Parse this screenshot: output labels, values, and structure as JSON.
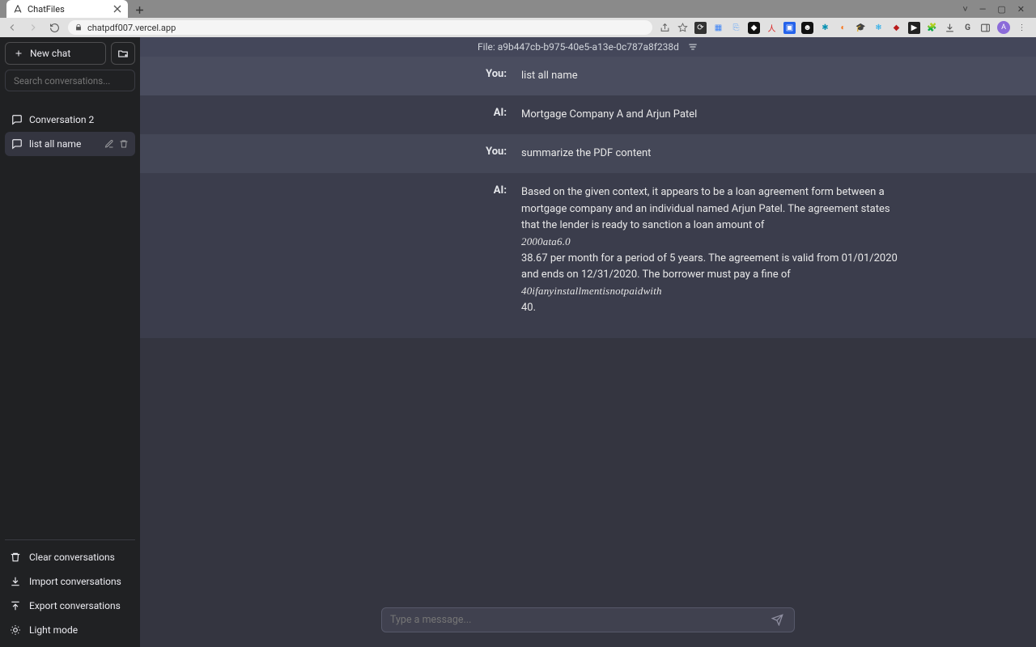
{
  "browser": {
    "tab_title": "ChatFiles",
    "url": "chatpdf007.vercel.app",
    "profile_initial": "A"
  },
  "sidebar": {
    "new_chat": "New chat",
    "search_placeholder": "Search conversations...",
    "conversations": [
      {
        "title": "Conversation 2"
      },
      {
        "title": "list all name"
      }
    ],
    "footer": {
      "clear": "Clear conversations",
      "import": "Import conversations",
      "export": "Export conversations",
      "light": "Light mode"
    }
  },
  "file_bar": {
    "label": "File: a9b447cb-b975-40e5-a13e-0c787a8f238d"
  },
  "labels": {
    "you": "You:",
    "ai": "AI:"
  },
  "messages": {
    "m0": {
      "role": "You:",
      "text": "list all name"
    },
    "m1": {
      "role": "AI:",
      "text": "Mortgage Company A and Arjun Patel"
    },
    "m2": {
      "role": "You:",
      "text": "summarize the PDF content"
    },
    "m3": {
      "role": "AI:",
      "p1": "Based on the given context, it appears to be a loan agreement form between a mortgage company and an individual named Arjun Patel. The agreement states that the lender is ready to sanction a loan amount of",
      "math1": "2000ata6.0",
      "p2": "38.67 per month for a period of 5 years. The agreement is valid from 01/01/2020 and ends on 12/31/2020. The borrower must pay a fine of",
      "math2": "40ifanyinstallmentisnotpaidwith",
      "p3": "40."
    }
  },
  "composer": {
    "placeholder": "Type a message..."
  }
}
